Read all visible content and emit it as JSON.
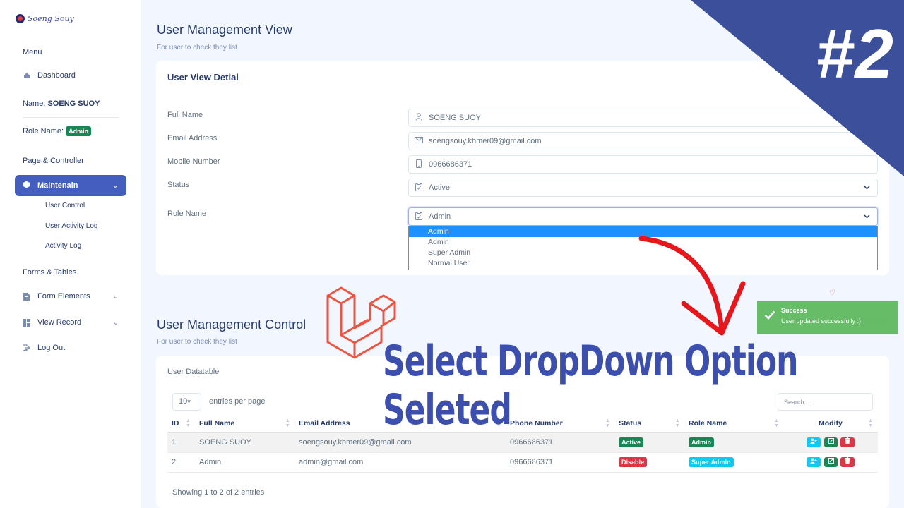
{
  "sidebar": {
    "logo_text": "Soeng Souy",
    "menu_title": "Menu",
    "dashboard": "Dashboard",
    "name_label": "Name:",
    "name_value": "SOENG SUOY",
    "role_label": "Role Name:",
    "role_value": "Admin",
    "section_page": "Page & Controller",
    "maintenance": "Maintenain",
    "sub_user_control": "User Control",
    "sub_user_activity": "User Activity Log",
    "sub_activity": "Activity Log",
    "section_forms": "Forms & Tables",
    "form_elements": "Form Elements",
    "view_record": "View Record",
    "log_out": "Log Out"
  },
  "view": {
    "title": "User Management View",
    "subtitle": "For user to check they list",
    "card_title": "User View Detial",
    "labels": {
      "full_name": "Full Name",
      "email": "Email Address",
      "mobile": "Mobile Number",
      "status": "Status",
      "role": "Role Name"
    },
    "values": {
      "full_name": "SOENG SUOY",
      "email": "soengsouy.khmer09@gmail.com",
      "mobile": "0966686371",
      "status": "Active",
      "role": "Admin"
    },
    "role_options": [
      "Admin",
      "Admin",
      "Super Admin",
      "Normal User"
    ]
  },
  "banner": {
    "text": "#2"
  },
  "overlay": {
    "text": "Select DropDown Option Seleted"
  },
  "toast": {
    "title": "Success",
    "message": "User updated successfully :)"
  },
  "faded_text": "gement",
  "control": {
    "title": "User Management Control",
    "subtitle": "For user to check they list",
    "datatable_label": "User Datatable",
    "per_page_value": "10",
    "per_page_label": "entries per page",
    "search_placeholder": "Search...",
    "columns": [
      "ID",
      "Full Name",
      "Email Address",
      "Phone Number",
      "Status",
      "Role Name",
      "Modify"
    ],
    "rows": [
      {
        "id": "1",
        "name": "SOENG SUOY",
        "email": "soengsouy.khmer09@gmail.com",
        "phone": "0966686371",
        "status": "Active",
        "role": "Admin"
      },
      {
        "id": "2",
        "name": "Admin",
        "email": "admin@gmail.com",
        "phone": "0966686371",
        "status": "Disable",
        "role": "Super Admin"
      }
    ],
    "info": "Showing 1 to 2 of 2 entries"
  },
  "colors": {
    "primary": "#435ebe",
    "success": "#198754",
    "danger": "#dc3545",
    "info": "#0dcaf0",
    "banner": "#3b4f9a"
  }
}
